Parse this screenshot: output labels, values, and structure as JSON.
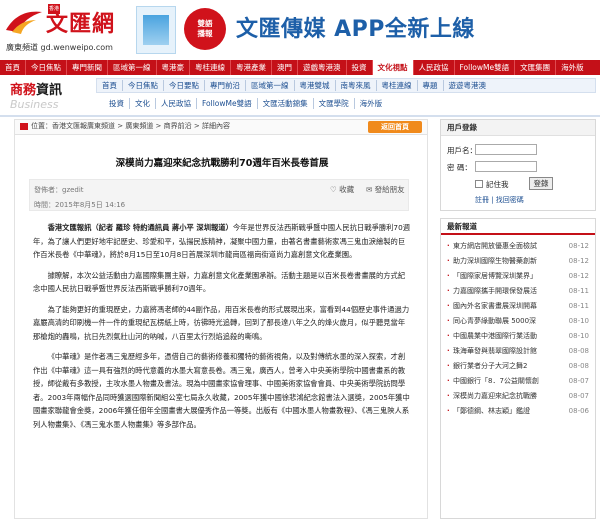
{
  "logo": {
    "brand": "文匯網",
    "badge": "香港",
    "sub": "廣東頻道  gd.wenweipo.com"
  },
  "banner": {
    "circle": "雙語\n播報",
    "text": "文匯傳媒 APP全新上線"
  },
  "nav_red": [
    "首頁",
    "今日焦點",
    "專門新聞",
    "區域第一線",
    "粵港豪",
    "粵桂連線",
    "粵港產業",
    "澳門",
    "遊戲粵港澳",
    "投資",
    "文化視點",
    "人民政協",
    "FollowMe雙語",
    "文匯集團",
    "海外版"
  ],
  "section": {
    "cn_left": "商務",
    "cn_right": "資訊",
    "en": "Business"
  },
  "subnav1": [
    "首頁",
    "今日焦點",
    "今日要點",
    "專門前沿",
    "區域第一線",
    "粵港雙城",
    "南粵來風",
    "粵桂連線",
    "專題",
    "遊遊粵港澳"
  ],
  "subnav2": [
    "投資",
    "文化",
    "人民政協",
    "FollowMe雙語",
    "文匯活動錦集",
    "文匯學院",
    "海外版"
  ],
  "breadcrumb": "位置：香港文匯報廣東頻道 > 廣東頻道 > 商界前沿 > 詳細內容",
  "back_button": "返回首頁",
  "article": {
    "title": "深模尚力嘉迎來紀念抗戰勝利70週年百米長卷首展",
    "author": "發佈者：gzedit",
    "time": "時間：2015年8月5日 14:16",
    "fav": "收藏",
    "share": "發給朋友",
    "lead": "香港文匯報訊（記者 羅珍 特約通訊員 蔣小平 深圳報道）",
    "p1_rest": "今年是世界反法西斯戰爭暨中國人民抗日戰爭勝利70週年，為了讓人們更好地牢記歷史、珍愛和平，弘揚民族精神，凝聚中國力量，由著名書畫藝術家馮三鬼血淚繪製的巨作百米長卷《中華魂》，將於8月15日至10月8日首展深圳市龍崗區福崗街道尚力嘉創意文化產業園。",
    "p2": "據瞭解，本次公益活動由力嘉國際集團主辦，力嘉創意文化產業園承辦。活動主題是以百米長卷書畫展的方式紀念中國人民抗日戰爭暨世界反法西斯戰爭勝利70週年。",
    "p3": "為了能夠更好的重現歷史，力嘉將馮老師的44副作品，用百米長卷的形式展現出來，富看到44個歷史事件通過力嘉嚴高清的印刷機一件一件的重現紀瓦楞紙上時，彷彿時光追轉，回到了那長達八年之久的烽火歲月，似乎聽見當年那槍炮的轟鳴，抗日先烈氣壯山河的吶喊，八百里太行烈焰追殺的嘶鳴。",
    "p4": "《中華魂》是作者馮三鬼歷經多年，憑借自己的藝術修養和獨特的藝術視角，以及對傳統水墨的深入探索，才創作出《中華魂》這一具有強烈的時代意義的水墨大寫意長卷。馮三鬼，廣西人，曾考入中央美術學院中國書畫系的教授，師從戴有多教授，主攻水墨人物畫及書法。現為中國畫家協會理事、中國美術家協會會員、中央美術學院訪問學者。2003年兩幅作品同時獲選國際新聞組公室七局永久收藏，2005年獲中國徐悲鴻紀念館書法入選獎，2005年獲中國畫家聯龍會金獎，2006年獲任佃年全國畫書大展優秀作品一等獎。出版有《中國水墨人物畫教程》、《馮三鬼陝人系列人物畫集》、《馮三鬼水墨人物畫集》等多部作品。"
  },
  "login": {
    "title": "用戶登錄",
    "user_label": "用戶名：",
    "pass_label": "密  碼：",
    "remember": "記住我",
    "submit": "登錄",
    "links": "註冊 | 找回密碼"
  },
  "latest": {
    "title": "最新報道",
    "items": [
      {
        "t": "東方網店開放優惠全面檢試",
        "d": "08-12"
      },
      {
        "t": "助力深圳國際生物醫藥創新",
        "d": "08-12"
      },
      {
        "t": "「國際家居博覽深圳業界」",
        "d": "08-12"
      },
      {
        "t": "力嘉國際攜手開環保發展活",
        "d": "08-11"
      },
      {
        "t": "國內外名家書畫展深圳開幕",
        "d": "08-11"
      },
      {
        "t": "同心青夢綠動聯展 5000深",
        "d": "08-10"
      },
      {
        "t": "中國農業中港國際行業活動",
        "d": "08-10"
      },
      {
        "t": "珠海華發與翡翠國際設計館",
        "d": "08-08"
      },
      {
        "t": "銀行業者分子大河之舞2",
        "d": "08-08"
      },
      {
        "t": "中國銀行「8．7公益關懷創",
        "d": "08-07"
      },
      {
        "t": "深模尚力嘉迎來紀念抗戰勝",
        "d": "08-07"
      },
      {
        "t": "「鄭德鋼、林志穎」鑑證",
        "d": "08-06"
      }
    ]
  },
  "colors": {
    "brand_red": "#c41018",
    "link_blue": "#1d4f91",
    "accent_orange": "#f08a1c"
  }
}
